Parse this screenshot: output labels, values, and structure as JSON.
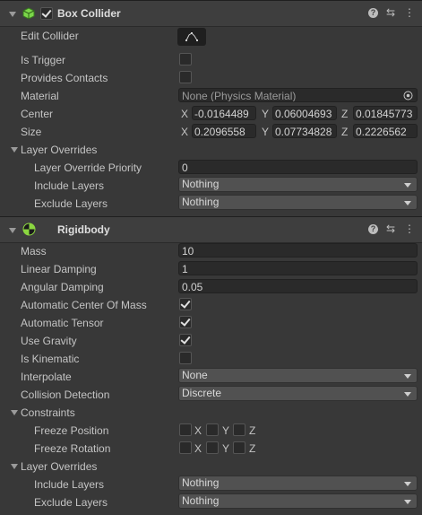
{
  "box_collider": {
    "title": "Box Collider",
    "edit_collider_label": "Edit Collider",
    "is_trigger_label": "Is Trigger",
    "provides_contacts_label": "Provides Contacts",
    "material_label": "Material",
    "material_value": "None (Physics Material)",
    "center_label": "Center",
    "center": {
      "x": "-0.0164489",
      "y": "0.06004693",
      "z": "0.01845773"
    },
    "size_label": "Size",
    "size": {
      "x": "0.2096558",
      "y": "0.07734828",
      "z": "0.2226562"
    },
    "layer_overrides_label": "Layer Overrides",
    "priority_label": "Layer Override Priority",
    "priority_value": "0",
    "include_layers_label": "Include Layers",
    "include_layers_value": "Nothing",
    "exclude_layers_label": "Exclude Layers",
    "exclude_layers_value": "Nothing"
  },
  "rigidbody": {
    "title": "Rigidbody",
    "mass_label": "Mass",
    "mass_value": "10",
    "linear_damping_label": "Linear Damping",
    "linear_damping_value": "1",
    "angular_damping_label": "Angular Damping",
    "angular_damping_value": "0.05",
    "auto_com_label": "Automatic Center Of Mass",
    "auto_tensor_label": "Automatic Tensor",
    "use_gravity_label": "Use Gravity",
    "is_kinematic_label": "Is Kinematic",
    "interpolate_label": "Interpolate",
    "interpolate_value": "None",
    "collision_detection_label": "Collision Detection",
    "collision_detection_value": "Discrete",
    "constraints_label": "Constraints",
    "freeze_position_label": "Freeze Position",
    "freeze_rotation_label": "Freeze Rotation",
    "layer_overrides_label": "Layer Overrides",
    "include_layers_label": "Include Layers",
    "include_layers_value": "Nothing",
    "exclude_layers_label": "Exclude Layers",
    "exclude_layers_value": "Nothing"
  },
  "axes": {
    "x": "X",
    "y": "Y",
    "z": "Z"
  },
  "icons": {
    "help": "?",
    "presets": "⇆",
    "menu": "⋮"
  },
  "colors": {
    "box_collider_icon": "#7bd64a",
    "rigidbody_icon": "#8bd640"
  }
}
